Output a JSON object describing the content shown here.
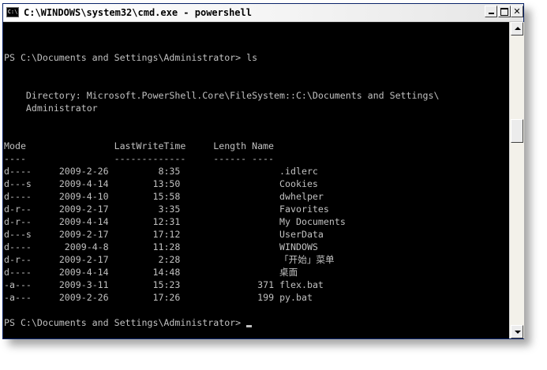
{
  "window": {
    "title": "C:\\WINDOWS\\system32\\cmd.exe - powershell",
    "icon": "cmd-icon",
    "buttons": {
      "minimize": "minimize-icon",
      "maximize": "maximize-icon",
      "close_label": "✕"
    }
  },
  "console": {
    "prompt_line": "PS C:\\Documents and Settings\\Administrator> ls",
    "directory_line_1": "    Directory: Microsoft.PowerShell.Core\\FileSystem::C:\\Documents and Settings\\",
    "directory_line_2": "    Administrator",
    "header": "Mode                LastWriteTime     Length Name",
    "underline": "----                -------------     ------ ----",
    "rows": [
      {
        "mode": "d----",
        "date": "2009-2-26",
        "time": "8:35",
        "length": "",
        "name": ".idlerc"
      },
      {
        "mode": "d---s",
        "date": "2009-4-14",
        "time": "13:50",
        "length": "",
        "name": "Cookies"
      },
      {
        "mode": "d----",
        "date": "2009-4-10",
        "time": "15:58",
        "length": "",
        "name": "dwhelper"
      },
      {
        "mode": "d-r--",
        "date": "2009-2-17",
        "time": "3:35",
        "length": "",
        "name": "Favorites"
      },
      {
        "mode": "d-r--",
        "date": "2009-4-14",
        "time": "12:31",
        "length": "",
        "name": "My Documents"
      },
      {
        "mode": "d---s",
        "date": "2009-2-17",
        "time": "17:12",
        "length": "",
        "name": "UserData"
      },
      {
        "mode": "d----",
        "date": "2009-4-8",
        "time": "11:28",
        "length": "",
        "name": "WINDOWS"
      },
      {
        "mode": "d-r--",
        "date": "2009-2-17",
        "time": "2:28",
        "length": "",
        "name": "「开始」菜单"
      },
      {
        "mode": "d----",
        "date": "2009-4-14",
        "time": "14:48",
        "length": "",
        "name": "桌面"
      },
      {
        "mode": "-a---",
        "date": "2009-3-11",
        "time": "15:23",
        "length": "371",
        "name": "flex.bat"
      },
      {
        "mode": "-a---",
        "date": "2009-2-26",
        "time": "17:26",
        "length": "199",
        "name": "py.bat"
      }
    ],
    "final_prompt": "PS C:\\Documents and Settings\\Administrator> "
  },
  "colors": {
    "console_bg": "#000000",
    "console_fg": "#c0c0c0"
  }
}
